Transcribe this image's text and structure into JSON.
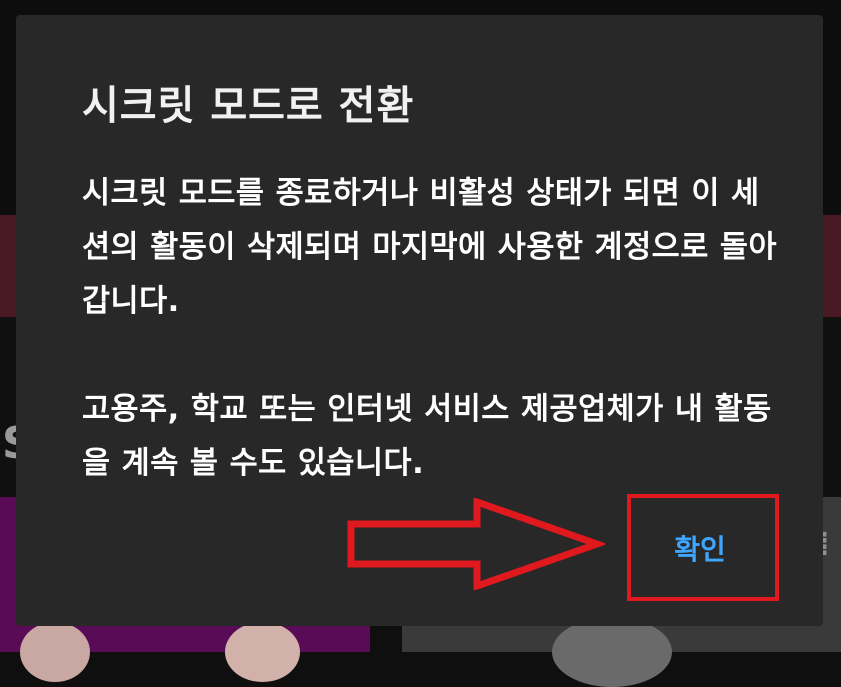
{
  "dialog": {
    "title": "시크릿 모드로 전환",
    "body_paragraph_1": "시크릿 모드를 종료하거나 비활성 상태가 되면 이 세션의 활동이 삭제되며 마지막에 사용한 계정으로 돌아갑니다.",
    "body_paragraph_2": "고용주, 학교 또는 인터넷 서비스 제공업체가 내 활동을 계속 볼 수도 있습니다.",
    "confirm_label": "확인"
  },
  "background": {
    "partial_letter": "S"
  },
  "annotation": {
    "arrow": "right-arrow-icon",
    "box_color": "#e0191f"
  },
  "colors": {
    "dialog_bg": "#282828",
    "accent": "#3ea6ff",
    "annotation_red": "#e0191f"
  }
}
